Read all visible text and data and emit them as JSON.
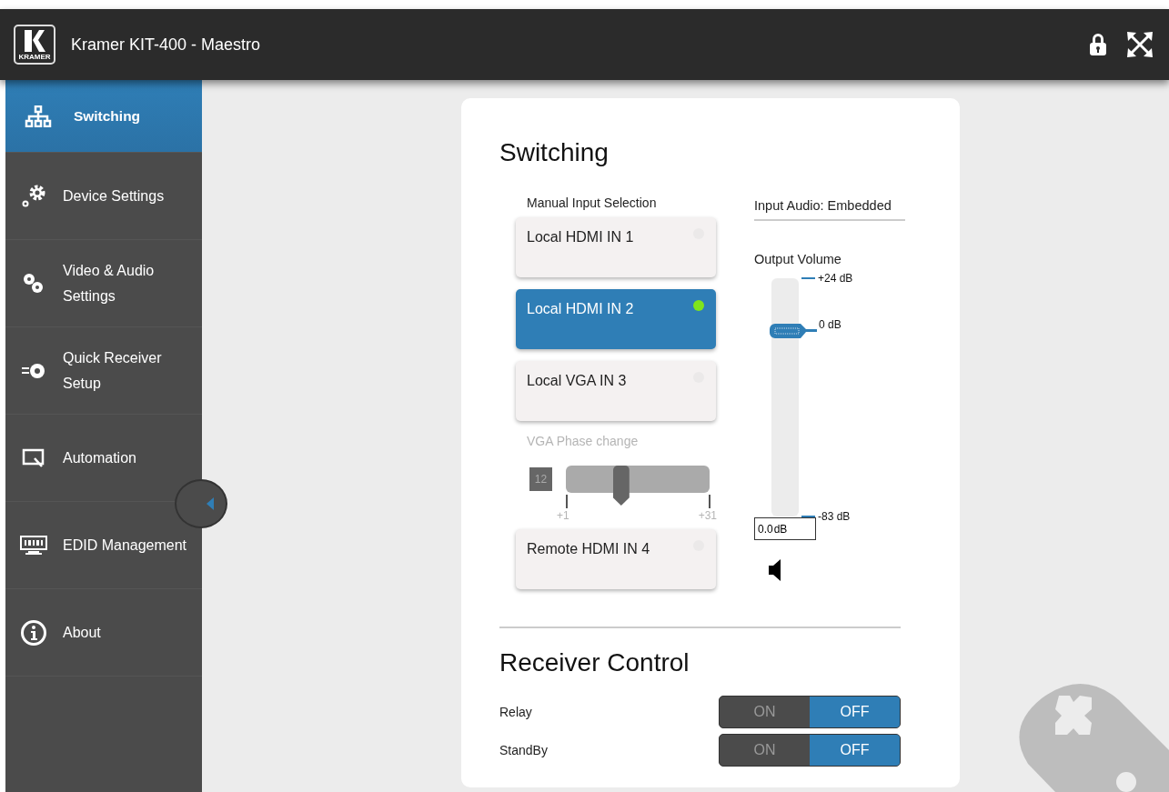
{
  "header": {
    "logo_text": "KRAMER",
    "title": "Kramer KIT-400 - Maestro"
  },
  "sidebar": {
    "items": [
      {
        "kind": "switching",
        "label": "Switching",
        "selected": true
      },
      {
        "kind": "device",
        "label": "Device Settings",
        "selected": false
      },
      {
        "kind": "video",
        "label": "Video & Audio Settings",
        "selected": false
      },
      {
        "kind": "quick",
        "label": "Quick Receiver Setup",
        "selected": false
      },
      {
        "kind": "automation",
        "label": "Automation",
        "selected": false
      },
      {
        "kind": "edid",
        "label": "EDID Management",
        "selected": false
      },
      {
        "kind": "about",
        "label": "About",
        "selected": false
      }
    ]
  },
  "switching": {
    "title": "Switching",
    "selection_label": "Manual Input Selection",
    "inputs": [
      {
        "label": "Local HDMI IN 1",
        "selected": false,
        "signal": false
      },
      {
        "label": "Local HDMI IN 2",
        "selected": true,
        "signal": true
      },
      {
        "label": "Local VGA IN 3",
        "selected": false,
        "signal": false
      },
      {
        "label": "Remote HDMI IN 4",
        "selected": false,
        "signal": false
      }
    ],
    "vga_phase": {
      "label": "VGA Phase change",
      "value": "12",
      "level": 0.37,
      "min": "+1",
      "max": "+31",
      "disabled": true
    },
    "input_audio": "Input Audio: Embedded",
    "volume": {
      "label": "Output Volume",
      "level": 0.78,
      "max_label": "+24 dB",
      "current_label": "0 dB",
      "min_label": "-83 dB",
      "value": "0.0",
      "unit": "dB"
    }
  },
  "receiver_control": {
    "title": "Receiver Control",
    "rows": [
      {
        "label": "Relay",
        "on_label": "ON",
        "off_label": "OFF",
        "on": false
      },
      {
        "label": "StandBy",
        "on_label": "ON",
        "off_label": "OFF",
        "on": false
      }
    ]
  }
}
